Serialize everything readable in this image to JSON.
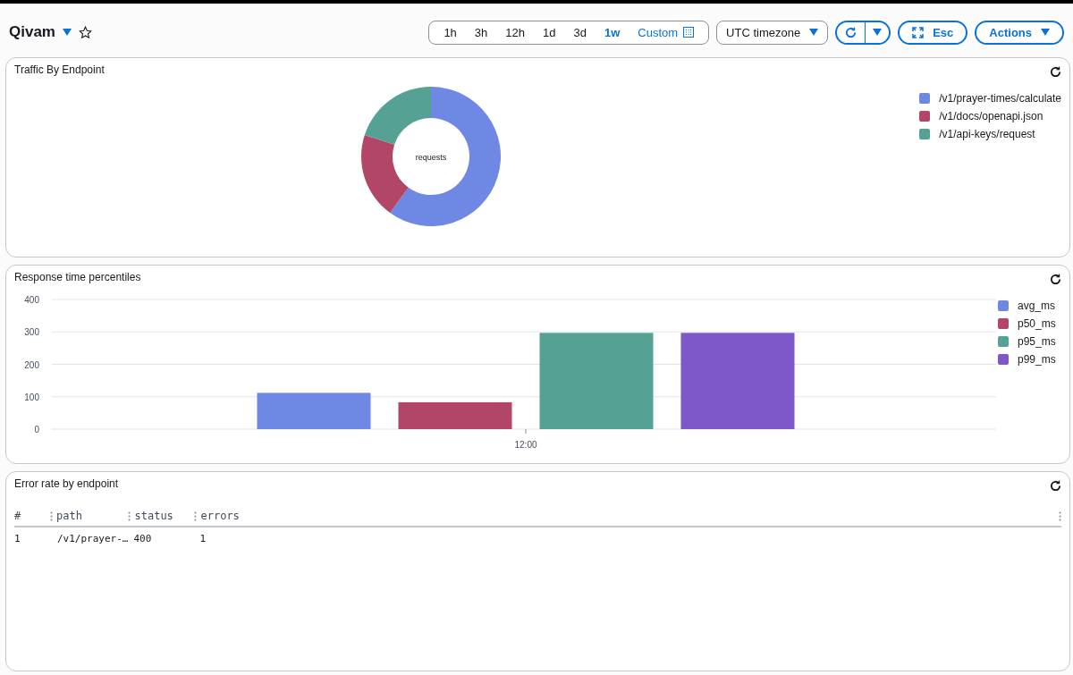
{
  "header": {
    "title": "Qivam",
    "favorite": false
  },
  "time_ranges": [
    {
      "label": "1h",
      "selected": false
    },
    {
      "label": "3h",
      "selected": false
    },
    {
      "label": "12h",
      "selected": false
    },
    {
      "label": "1d",
      "selected": false
    },
    {
      "label": "3d",
      "selected": false
    },
    {
      "label": "1w",
      "selected": true
    },
    {
      "label": "Custom",
      "selected": false
    }
  ],
  "timezone": "UTC timezone",
  "esc_button": "Esc",
  "actions_button": "Actions",
  "traffic_panel": {
    "title": "Traffic By Endpoint",
    "chart_data": {
      "type": "donut",
      "categories": [
        "/v1/prayer-times/calculate",
        "/v1/docs/openapi.json",
        "/v1/api-keys/request"
      ],
      "series": [
        {
          "name": "requests",
          "values": [
            0.6,
            0.2,
            0.2
          ]
        }
      ],
      "colors": [
        "#6f88e3",
        "#b24667",
        "#55a294"
      ]
    }
  },
  "response_panel": {
    "title": "Response time percentiles",
    "chart_data": {
      "type": "bar",
      "categories": [
        "12:00"
      ],
      "series": [
        {
          "name": "avg_ms",
          "color": "#6f88e3",
          "values": [
            112
          ]
        },
        {
          "name": "p50_ms",
          "color": "#b24667",
          "values": [
            83
          ]
        },
        {
          "name": "p95_ms",
          "color": "#55a294",
          "values": [
            297
          ]
        },
        {
          "name": "p99_ms",
          "color": "#7e57c8",
          "values": [
            297
          ]
        }
      ],
      "ylim": [
        0,
        400
      ],
      "grid": true,
      "yticks": [
        0,
        100,
        200,
        300,
        400
      ]
    }
  },
  "error_panel": {
    "title": "Error rate by endpoint",
    "columns": [
      "#",
      "path",
      "status",
      "errors"
    ],
    "rows": [
      [
        "1",
        "/v1/prayer-…",
        "400",
        "1"
      ]
    ]
  }
}
